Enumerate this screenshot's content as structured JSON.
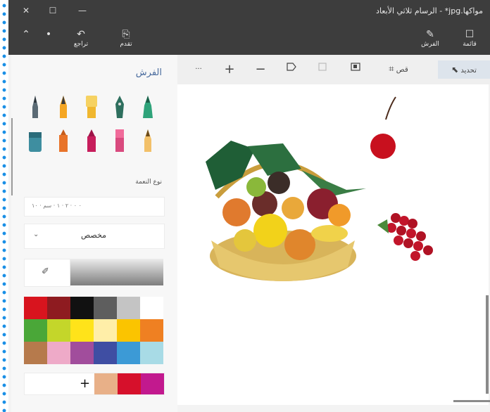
{
  "window": {
    "title": "مواكها.jpg* - الرسام ثلاثي الأبعاد",
    "minimize_glyph": "—",
    "maximize_glyph": "☐",
    "close_glyph": "✕"
  },
  "ribbon": {
    "menu_label": "قائمة",
    "brushes_label": "الفرش",
    "redo_label": "تقدم",
    "undo_label": "تراجع",
    "collapse_glyph": "⌃",
    "more_glyph": "•"
  },
  "toolbar": {
    "select_label": "تحديد",
    "crop_label": "قص",
    "more_glyph": "···",
    "plus_glyph": "+",
    "minus_glyph": "−"
  },
  "brushes_panel": {
    "title": "الفرش",
    "texture_label": "نوع النعمة",
    "slider_ticks": "٠ ٠ · ٢ · ١ · سم · ١٠",
    "preset_value": "مخصص",
    "add_color_glyph": "+"
  },
  "colors": {
    "accent": "#4a6c9e",
    "palette": [
      "#d8141e",
      "#8e1b20",
      "#111111",
      "#5e5e5e",
      "#c4c4c4",
      "#ffffff",
      "#4aa738",
      "#c4d62a",
      "#ffe31a",
      "#ffeea8",
      "#fbc400",
      "#ef8022",
      "#b67a4c",
      "#eeaac8",
      "#a14d9c",
      "#3f4ea3",
      "#3c9ad6",
      "#a8dbe6"
    ],
    "custom": [
      "#e8b088",
      "#d6102b",
      "#c2198e"
    ]
  },
  "icons": [
    "pen-icon",
    "pencil-icon",
    "brush-icon",
    "calligraphy-icon",
    "marker-icon",
    "fill-icon",
    "crayon-icon",
    "spray-icon",
    "select-icon",
    "crop-icon",
    "undo-icon",
    "redo-icon",
    "eyedropper-icon"
  ]
}
